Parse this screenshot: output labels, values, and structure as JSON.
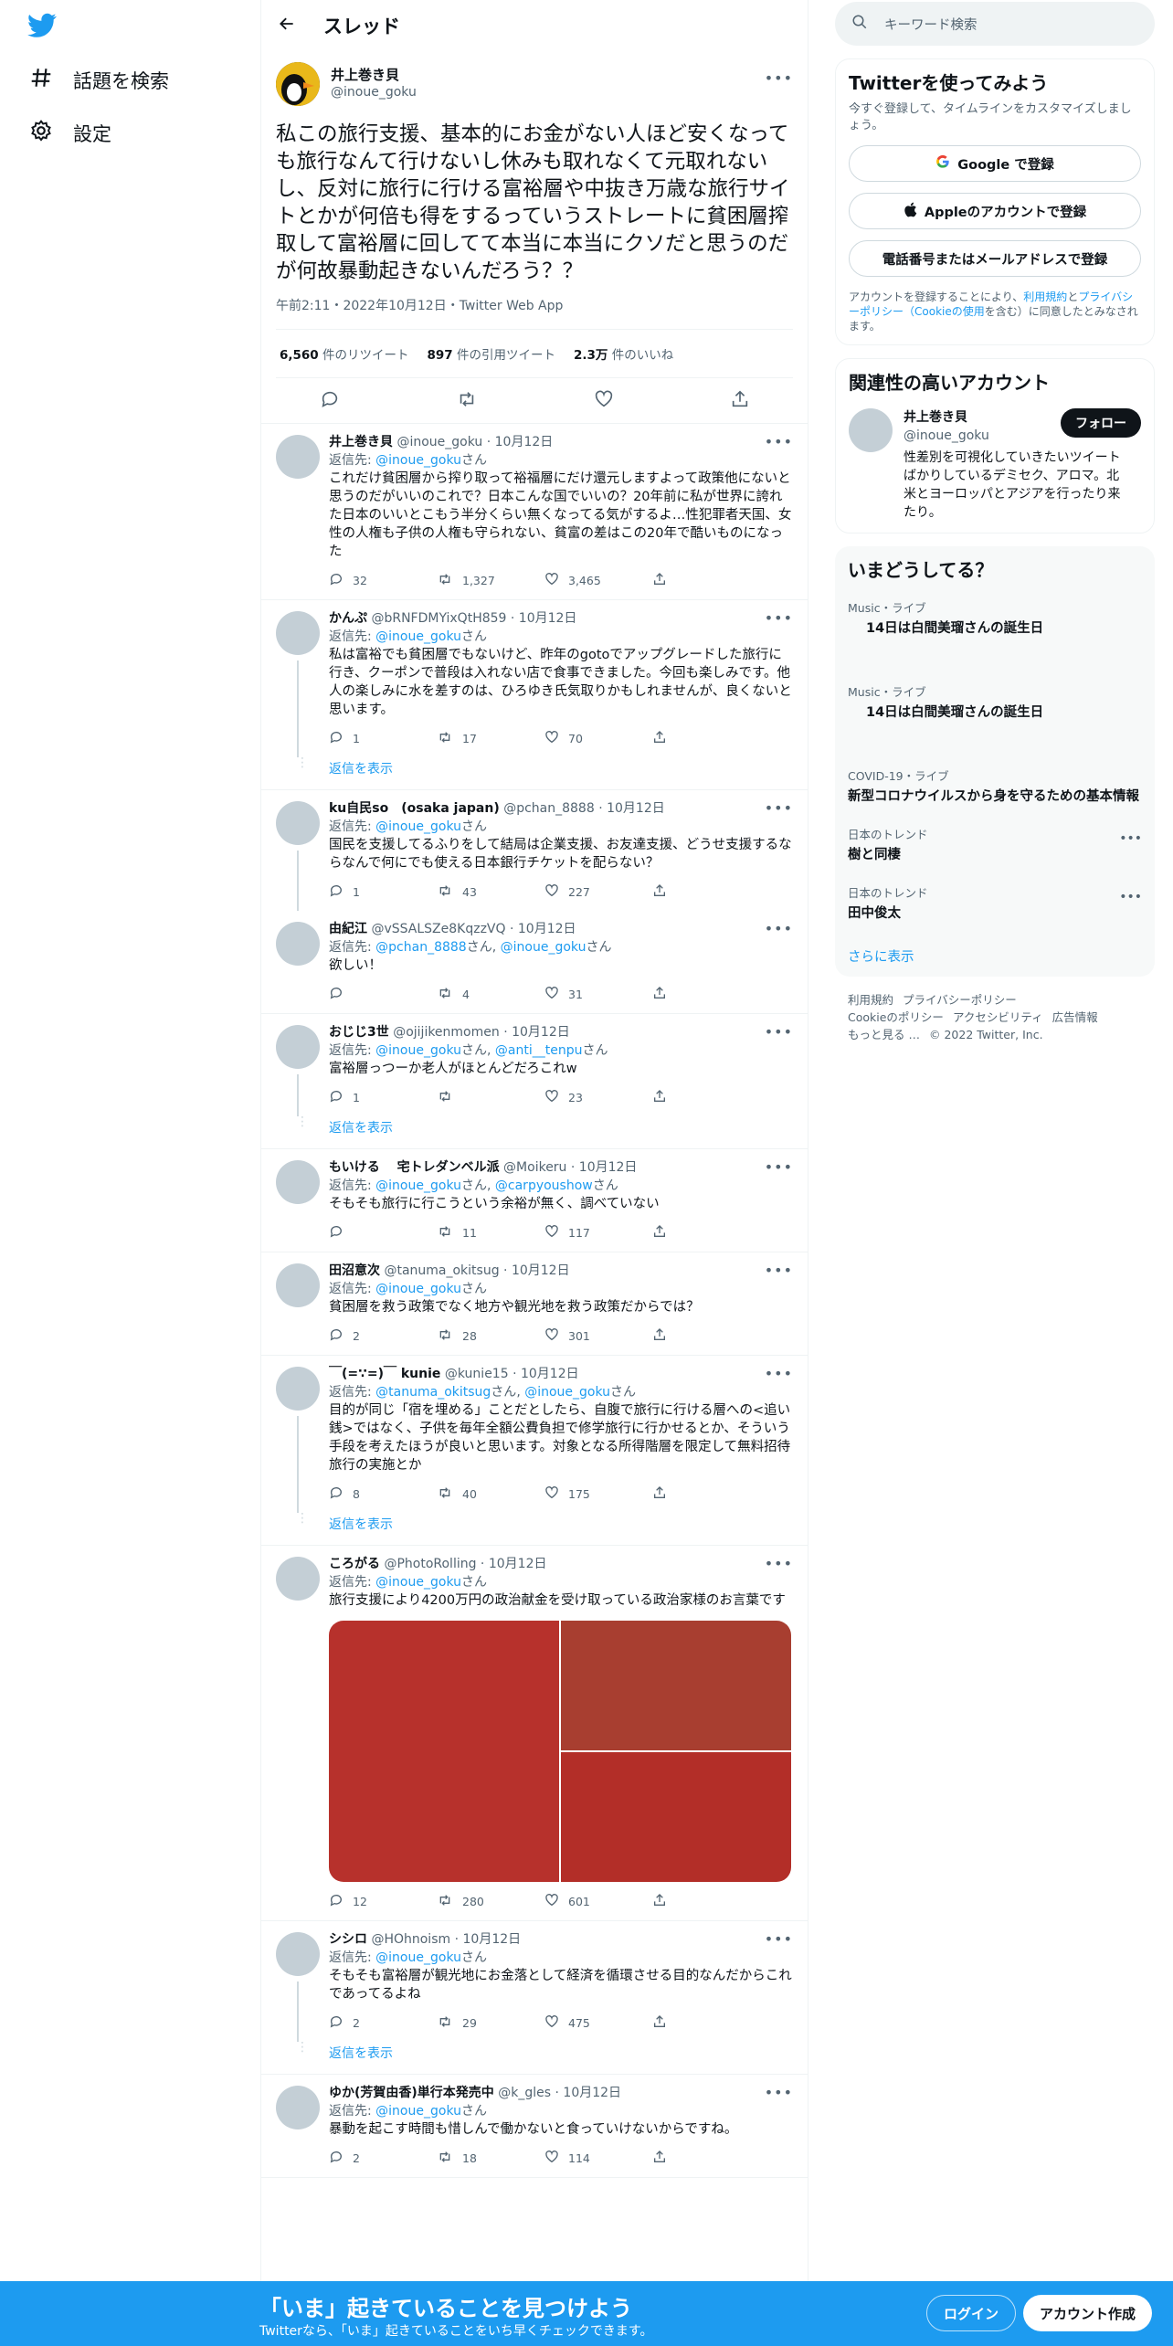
{
  "nav": {
    "explore": "話題を検索",
    "settings": "設定"
  },
  "header": {
    "title": "スレッド"
  },
  "main_tweet": {
    "name": "井上巻き貝",
    "handle": "@inoue_goku",
    "text": "私この旅行支援、基本的にお金がない人ほど安くなっても旅行なんて行けないし休みも取れなくて元取れないし、反対に旅行に行ける富裕層や中抜き万歳な旅行サイトとかが何倍も得をするっていうストレートに貧困層搾取して富裕層に回してて本当に本当にクソだと思うのだが何故暴動起きないんだろう？？",
    "meta": "午前2:11・2022年10月12日・Twitter Web App",
    "retweets": "6,560",
    "retweets_label": "件のリツイート",
    "quotes": "897",
    "quotes_label": "件の引用ツイート",
    "likes": "2.3万",
    "likes_label": "件のいいね"
  },
  "reply_prefix": "返信先: ",
  "san": "さん",
  "show_replies": "返信を表示",
  "replies": [
    {
      "name": "井上巻き貝",
      "handle": "@inoue_goku",
      "date": "10月12日",
      "to": [
        "@inoue_goku"
      ],
      "text": "これだけ貧困層から搾り取って裕福層にだけ還元しますよって政策他にないと思うのだがいいのこれで？日本こんな国でいいの？20年前に私が世界に誇れた日本のいいとこもう半分くらい無くなってる気がするよ…性犯罪者天国、女性の人権も子供の人権も守られない、貧富の差はこの20年で酷いものになった",
      "r": "32",
      "rt": "1,327",
      "l": "3,465"
    },
    {
      "name": "かんぷ",
      "handle": "@bRNFDMYixQtH859",
      "date": "10月12日",
      "to": [
        "@inoue_goku"
      ],
      "text": "私は富裕でも貧困層でもないけど、昨年のgotoでアップグレードした旅行に行き、クーポンで普段は入れない店で食事できました。今回も楽しみです。他人の楽しみに水を差すのは、ひろゆき氏気取りかもしれませんが、良くないと思います。",
      "r": "1",
      "rt": "17",
      "l": "70"
    },
    {
      "name": "ku自民so　(osaka japan)",
      "handle": "@pchan_8888",
      "date": "10月12日",
      "to": [
        "@inoue_goku"
      ],
      "text": "国民を支援してるふりをして結局は企業支援、お友達支援、どうせ支援するならなんで何にでも使える日本銀行チケットを配らない？",
      "r": "1",
      "rt": "43",
      "l": "227"
    },
    {
      "name": "由紀江",
      "handle": "@vSSALSZe8KqzzVQ",
      "date": "10月12日",
      "to": [
        "@pchan_8888",
        "@inoue_goku"
      ],
      "text": "欲しい！",
      "r": "",
      "rt": "4",
      "l": "31"
    },
    {
      "name": "おじじ3世",
      "handle": "@ojijikenmomen",
      "date": "10月12日",
      "to": [
        "@inoue_goku",
        "@anti__tenpu"
      ],
      "text": "富裕層っつーか老人がほとんどだろこれw",
      "r": "1",
      "rt": "",
      "l": "23"
    },
    {
      "name": "もいける　 宅トレダンベル派",
      "handle": "@Moikeru",
      "date": "10月12日",
      "to": [
        "@inoue_goku",
        "@carpyoushow"
      ],
      "text": "そもそも旅行に行こうという余裕が無く、調べていない",
      "r": "",
      "rt": "11",
      "l": "117"
    },
    {
      "name": "田沼意次",
      "handle": "@tanuma_okitsug",
      "date": "10月12日",
      "to": [
        "@inoue_goku"
      ],
      "text": "貧困層を救う政策でなく地方や観光地を救う政策だからでは？",
      "r": "2",
      "rt": "28",
      "l": "301"
    },
    {
      "name": "￣(=∵=)￣ kunie",
      "handle": "@kunie15",
      "date": "10月12日",
      "to": [
        "@tanuma_okitsug",
        "@inoue_goku"
      ],
      "text": "目的が同じ「宿を埋める」ことだとしたら、自腹で旅行に行ける層への<追い銭>ではなく、子供を毎年全額公費負担で修学旅行に行かせるとか、そういう手段を考えたほうが良いと思います。対象となる所得階層を限定して無料招待旅行の実施とか",
      "r": "8",
      "rt": "40",
      "l": "175"
    },
    {
      "name": "ころがる",
      "handle": "@PhotoRolling",
      "date": "10月12日",
      "to": [
        "@inoue_goku"
      ],
      "text": "旅行支援により4200万円の政治献金を受け取っている政治家様のお言葉です",
      "r": "12",
      "rt": "280",
      "l": "601"
    },
    {
      "name": "シシロ",
      "handle": "@HOhnoism",
      "date": "10月12日",
      "to": [
        "@inoue_goku"
      ],
      "text": "そもそも富裕層が観光地にお金落として経済を循環させる目的なんだからこれであってるよね",
      "r": "2",
      "rt": "29",
      "l": "475"
    },
    {
      "name": "ゆか(芳賀由香)単行本発売中",
      "handle": "@k_gles",
      "date": "10月12日",
      "to": [
        "@inoue_goku"
      ],
      "text": "暴動を起こす時間も惜しんで働かないと食っていけないからですね。",
      "r": "2",
      "rt": "18",
      "l": "114"
    }
  ],
  "search": {
    "placeholder": "キーワード検索"
  },
  "signup": {
    "title": "Twitterを使ってみよう",
    "sub": "今すぐ登録して、タイムラインをカスタマイズしましょう。",
    "google": "Google で登録",
    "apple": "Appleのアカウントで登録",
    "phone": "電話番号またはメールアドレスで登録",
    "terms_a": "アカウントを登録することにより、",
    "terms_l1": "利用規約",
    "terms_b": "と",
    "terms_l2": "プライバシーポリシー（Cookieの使用",
    "terms_c": "を含む）に同意したとみなされます。"
  },
  "related": {
    "title": "関連性の高いアカウント",
    "name": "井上巻き貝",
    "handle": "@inoue_goku",
    "follow": "フォロー",
    "bio": "性差別を可視化していきたいツイートばかりしているデミセク、アロマ。北米とヨーロッパとアジアを行ったり来たり。"
  },
  "trends": {
    "title": "いまどうしてる？",
    "items": [
      {
        "cat": "Music・ライブ",
        "text": "14日は白間美瑠さんの誕生日"
      },
      {
        "cat": "Music・ライブ",
        "text": "14日は白間美瑠さんの誕生日"
      },
      {
        "cat": "COVID-19・ライブ",
        "text": "新型コロナウイルスから身を守るための基本情報"
      },
      {
        "cat": "日本のトレンド",
        "text": "樹と同棲"
      },
      {
        "cat": "日本のトレンド",
        "text": "田中俊太"
      }
    ],
    "more": "さらに表示"
  },
  "footer": {
    "l1": "利用規約",
    "l2": "プライバシーポリシー",
    "l3": "Cookieのポリシー",
    "l4": "アクセシビリティ",
    "l5": "広告情報",
    "l6": "もっと見る …",
    "copy": "© 2022 Twitter, Inc."
  },
  "bottom": {
    "headline": "「いま」起きていることを見つけよう",
    "sub": "Twitterなら、「いま」起きていることをいち早くチェックできます。",
    "login": "ログイン",
    "create": "アカウント作成"
  },
  "colors": {
    "accent": "#1d9bf0",
    "media": "#b7312c"
  }
}
